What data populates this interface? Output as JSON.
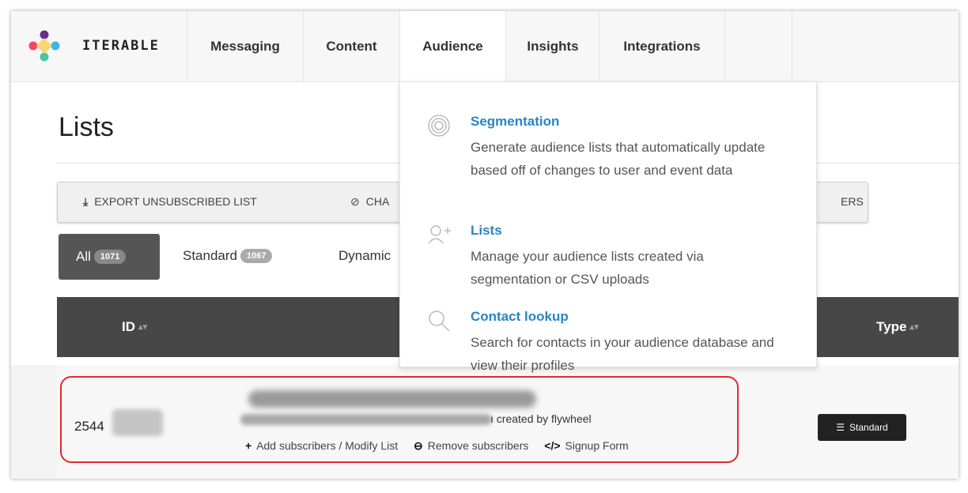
{
  "nav": {
    "brand": "ITERABLE",
    "items": [
      {
        "label": "Messaging"
      },
      {
        "label": "Content"
      },
      {
        "label": "Audience"
      },
      {
        "label": "Insights"
      },
      {
        "label": "Integrations"
      }
    ],
    "help_label": "?"
  },
  "page": {
    "title": "Lists",
    "buttons": {
      "export": "EXPORT UNSUBSCRIBED LIST",
      "cha": "CHA",
      "ers": "ERS"
    },
    "tabs": [
      {
        "label": "All",
        "count": "1071"
      },
      {
        "label": "Standard",
        "count": "1067"
      },
      {
        "label": "Dynamic"
      }
    ]
  },
  "table": {
    "columns": {
      "id": "ID",
      "type": "Type"
    },
    "row": {
      "id": "2544",
      "created": "created by flywheel",
      "actions": [
        "Add subscribers / Modify List",
        "Remove subscribers",
        "Signup Form"
      ],
      "type": "Standard"
    }
  },
  "dropdown": {
    "items": [
      {
        "title": "Segmentation",
        "desc": "Generate audience lists that automatically update based off of changes to user and event data",
        "icon": "target-icon"
      },
      {
        "title": "Lists",
        "desc": "Manage your audience lists created via segmentation or CSV uploads",
        "icon": "add-user-icon"
      },
      {
        "title": "Contact lookup",
        "desc": "Search for contacts in your audience database and view their profiles",
        "icon": "search-icon"
      }
    ]
  },
  "colors": {
    "link": "#2a84c4",
    "highlight": "#e12a2a",
    "header": "#474747"
  }
}
